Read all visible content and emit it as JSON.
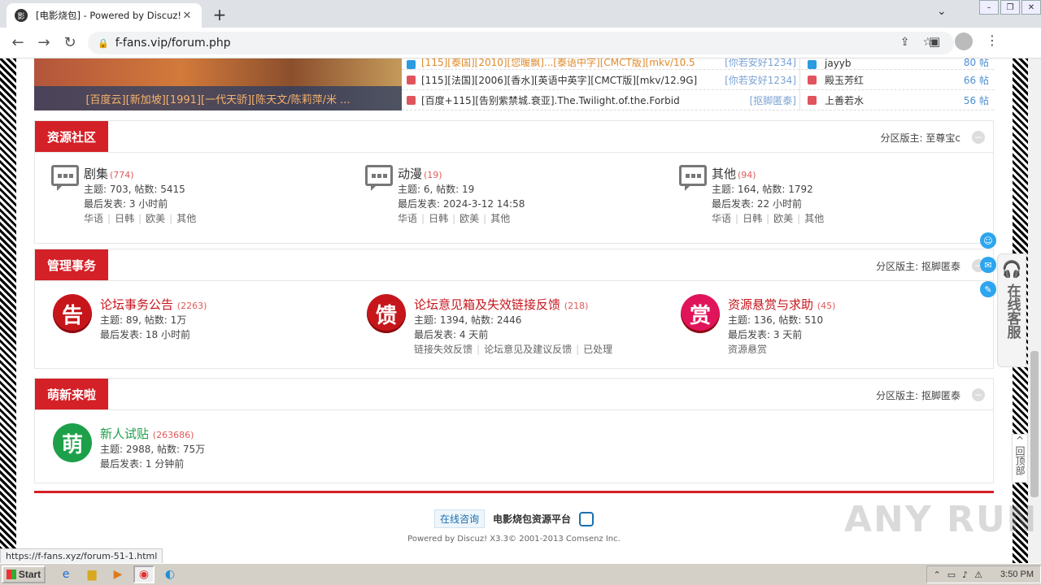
{
  "browser": {
    "tab_title": "[电影烧包] - Powered by Discuz!",
    "url": "f-fans.vip/forum.php",
    "status_url": "https://f-fans.xyz/forum-51-1.html"
  },
  "slide": {
    "caption": "[百度云][新加坡][1991][一代天骄][陈天文/陈莉萍/米 ..."
  },
  "threads": [
    {
      "title": "[115][泰国][2010][您暖飘]...[泰语中字][CMCT版][mkv/10.5",
      "author": "[你若安好1234]",
      "color": "#2b9be0"
    },
    {
      "title": "[115][法国][2006][香水][英语中英字][CMCT版][mkv/12.9G]",
      "author": "[你若安好1234]",
      "color": "#e0555d"
    },
    {
      "title": "[百度+115][告别紫禁城.衰亚].The.Twilight.of.the.Forbid",
      "author": "[抠脚匿泰]",
      "color": "#e0555d"
    }
  ],
  "ranks": [
    {
      "name": "jayyb",
      "count": "80 帖",
      "color": "#2b9be0"
    },
    {
      "name": "殿玉芳红",
      "count": "66 帖",
      "color": "#e0555d"
    },
    {
      "name": "上善若水",
      "count": "56 帖",
      "color": "#e0555d"
    }
  ],
  "sections": {
    "resources": {
      "label": "资源社区",
      "moderator": "分区版主: 至尊宝c",
      "forums": [
        {
          "name": "剧集",
          "count": "(774)",
          "stats": "主题: 703, 帖数: 5415",
          "last": "最后发表: 3 小时前",
          "subs": [
            "华语",
            "日韩",
            "欧美",
            "其他"
          ]
        },
        {
          "name": "动漫",
          "count": "(19)",
          "stats": "主题: 6, 帖数: 19",
          "last": "最后发表: 2024-3-12 14:58",
          "subs": [
            "华语",
            "日韩",
            "欧美",
            "其他"
          ]
        },
        {
          "name": "其他",
          "count": "(94)",
          "stats": "主题: 164, 帖数: 1792",
          "last": "最后发表: 22 小时前",
          "subs": [
            "华语",
            "日韩",
            "欧美",
            "其他"
          ]
        }
      ]
    },
    "admin": {
      "label": "管理事务",
      "moderator": "分区版主: 抠脚匿泰",
      "forums": [
        {
          "icon": "告",
          "name": "论坛事务公告",
          "count": "(2263)",
          "stats": "主题: 89, 帖数: 1万",
          "last": "最后发表: 18 小时前",
          "subs": []
        },
        {
          "icon": "馈",
          "name": "论坛意见箱及失效链接反馈",
          "count": "(218)",
          "stats": "主题: 1394, 帖数: 2446",
          "last": "最后发表: 4 天前",
          "subs": [
            "链接失效反馈",
            "论坛意见及建议反馈",
            "已处理"
          ]
        },
        {
          "icon": "赏",
          "name": "资源悬赏与求助",
          "count": "(45)",
          "stats": "主题: 136, 帖数: 510",
          "last": "最后发表: 3 天前",
          "subs": [
            "资源悬赏"
          ]
        }
      ]
    },
    "newbie": {
      "label": "萌新来啦",
      "moderator": "分区版主: 抠脚匿泰",
      "forums": [
        {
          "icon": "萌",
          "name": "新人试贴",
          "count": "(263686)",
          "stats": "主题: 2988, 帖数: 75万",
          "last": "最后发表: 1 分钟前"
        }
      ]
    }
  },
  "footer": {
    "consult": "在线咨询",
    "platform": "电影烧包资源平台",
    "powered": "Powered by Discuz! X3.3© 2001-2013 Comsenz Inc."
  },
  "service": {
    "text": "在线客服",
    "totop": "回顶部"
  },
  "watermark": "ANY RUN",
  "taskbar": {
    "start": "Start",
    "clock": "3:50 PM"
  }
}
